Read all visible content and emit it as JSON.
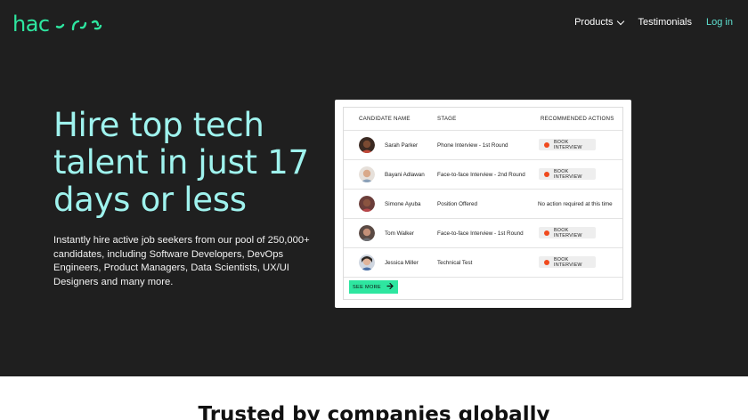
{
  "brand": {
    "logo_text": "hac",
    "accent": "#2ee6a0"
  },
  "nav": {
    "products": "Products",
    "testimonials": "Testimonials",
    "login": "Log in"
  },
  "hero": {
    "headline": "Hire top tech talent in just 17 days or less",
    "subcopy": "Instantly hire active job seekers from our pool of 250,000+ candidates, including Software Developers, DevOps Engineers, Product Managers, Data Scientists, UX/UI Designers and many more.",
    "background": "#1f1f1f",
    "headline_color": "#9ff3ee"
  },
  "table": {
    "headers": {
      "name": "CANDIDATE NAME",
      "stage": "STAGE",
      "actions": "RECOMMENDED ACTIONS"
    },
    "rows": [
      {
        "name": "Sarah Parker",
        "stage": "Phone Interview - 1st Round",
        "action": "BOOK INTERVIEW",
        "has_button": true
      },
      {
        "name": "Bayani Adlawan",
        "stage": "Face-to-face Interview - 2nd Round",
        "action": "BOOK INTERVIEW",
        "has_button": true
      },
      {
        "name": "Simone Ayuba",
        "stage": "Position Offered",
        "action": "No action required at this time",
        "has_button": false
      },
      {
        "name": "Tom Walker",
        "stage": "Face-to-face Interview - 1st Round",
        "action": "BOOK INTERVIEW",
        "has_button": true
      },
      {
        "name": "Jessica Miller",
        "stage": "Technical Test",
        "action": "BOOK INTERVIEW",
        "has_button": true
      }
    ],
    "see_more": "SEE MORE",
    "action_dot_color": "#f04a1e"
  },
  "trusted": {
    "heading": "Trusted by companies globally"
  }
}
